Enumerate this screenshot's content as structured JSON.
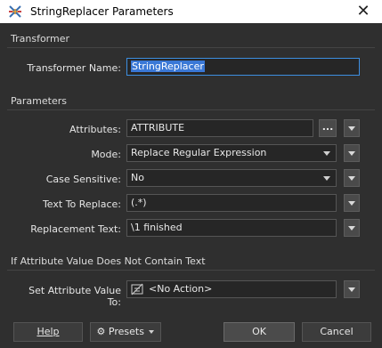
{
  "window": {
    "title": "StringReplacer Parameters",
    "close_glyph": "✕"
  },
  "transformer": {
    "section_title": "Transformer",
    "name_label": "Transformer Name:",
    "name_value": "StringReplacer"
  },
  "parameters": {
    "section_title": "Parameters",
    "attributes_label": "Attributes:",
    "attributes_value": "ATTRIBUTE",
    "attributes_browse": "...",
    "mode_label": "Mode:",
    "mode_value": "Replace Regular Expression",
    "case_label": "Case Sensitive:",
    "case_value": "No",
    "replace_label": "Text To Replace:",
    "replace_value": "(.*)",
    "replacement_label": "Replacement Text:",
    "replacement_value": "\\1 finished"
  },
  "nocontain": {
    "section_title": "If Attribute Value Does Not Contain Text",
    "set_label": "Set Attribute Value To:",
    "set_value": "<No Action>"
  },
  "buttons": {
    "help": "Help",
    "presets": "Presets",
    "ok": "OK",
    "cancel": "Cancel"
  },
  "icons": {
    "app": "transformer-icon",
    "noaction": "no-action-icon",
    "presets": "gear-icon"
  }
}
